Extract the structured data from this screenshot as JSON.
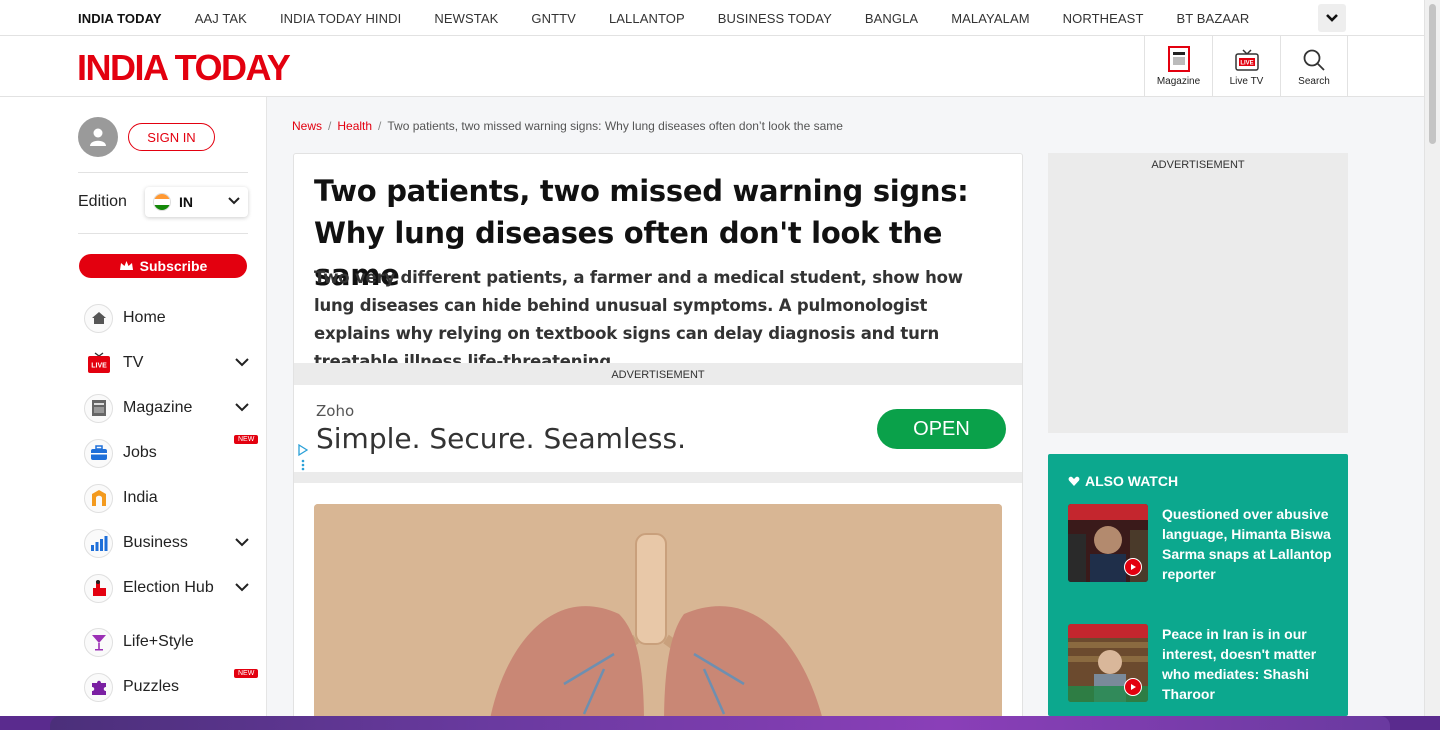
{
  "network_bar": {
    "items": [
      "INDIA TODAY",
      "AAJ TAK",
      "INDIA TODAY HINDI",
      "NEWSTAK",
      "GNTTV",
      "LALLANTOP",
      "BUSINESS TODAY",
      "BANGLA",
      "MALAYALAM",
      "NORTHEAST",
      "BT BAZAAR"
    ],
    "more_icon": "chevron-down-icon"
  },
  "header": {
    "logo": "INDIA TODAY",
    "buttons": [
      {
        "label": "Magazine",
        "icon": "magazine-icon"
      },
      {
        "label": "Live TV",
        "icon": "live-tv-icon"
      },
      {
        "label": "Search",
        "icon": "search-icon"
      }
    ]
  },
  "sidebar": {
    "sign_in": "SIGN IN",
    "edition_label": "Edition",
    "edition_value": "IN",
    "subscribe": "Subscribe",
    "items": [
      {
        "label": "Home",
        "icon": "home-icon",
        "has_chevron": false,
        "new": false
      },
      {
        "label": "TV",
        "icon": "live-icon",
        "has_chevron": true,
        "new": false
      },
      {
        "label": "Magazine",
        "icon": "magazine-icon",
        "has_chevron": true,
        "new": false
      },
      {
        "label": "Jobs",
        "icon": "briefcase-icon",
        "has_chevron": false,
        "new": true
      },
      {
        "label": "India",
        "icon": "india-gate-icon",
        "has_chevron": false,
        "new": false
      },
      {
        "label": "Business",
        "icon": "bar-chart-icon",
        "has_chevron": true,
        "new": false
      },
      {
        "label": "Election Hub",
        "icon": "ballot-icon",
        "has_chevron": true,
        "new": false
      },
      {
        "label": "Life+Style",
        "icon": "cocktail-icon",
        "has_chevron": false,
        "new": false
      },
      {
        "label": "Puzzles",
        "icon": "puzzle-icon",
        "has_chevron": false,
        "new": true
      }
    ],
    "new_badge": "NEW"
  },
  "breadcrumb": {
    "items": [
      "News",
      "Health"
    ],
    "current": "Two patients, two missed warning signs: Why lung diseases often don’t look the same"
  },
  "article": {
    "title": "Two patients, two missed warning signs: Why lung diseases often don't look the same",
    "summary": "Two very different patients, a farmer and a medical student, show how lung diseases can hide behind unusual symptoms. A pulmonologist explains why relying on textbook signs can delay diagnosis and turn treatable illness life-threatening."
  },
  "ad": {
    "label": "ADVERTISEMENT",
    "brand": "Zoho",
    "tagline": "Simple. Secure. Seamless.",
    "cta": "OPEN"
  },
  "right_ad": {
    "label": "ADVERTISEMENT"
  },
  "also_watch": {
    "heading": "ALSO WATCH",
    "items": [
      {
        "title": "Questioned over abusive language, Himanta Biswa Sarma snaps at Lallantop reporter"
      },
      {
        "title": "Peace in Iran is in our interest, doesn't matter who mediates: Shashi Tharoor"
      }
    ]
  },
  "colors": {
    "brand_red": "#e3000f",
    "watch_teal": "#0ca88e",
    "ad_green": "#0aa14a"
  }
}
